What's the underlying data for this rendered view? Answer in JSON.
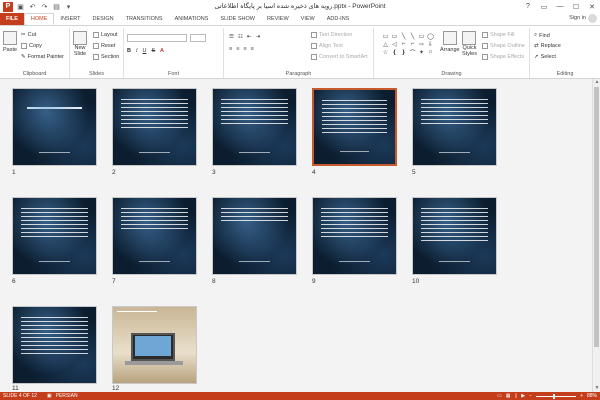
{
  "window": {
    "app_logo": "P",
    "title": "رویه های ذخیره شده اسیا بر پایگاه اطلاعاتی.pptx - PowerPoint",
    "controls": [
      "?",
      "▭",
      "—",
      "☐",
      "✕"
    ]
  },
  "tabs": [
    {
      "label": "FILE"
    },
    {
      "label": "HOME"
    },
    {
      "label": "INSERT"
    },
    {
      "label": "DESIGN"
    },
    {
      "label": "TRANSITIONS"
    },
    {
      "label": "ANIMATIONS"
    },
    {
      "label": "SLIDE SHOW"
    },
    {
      "label": "REVIEW"
    },
    {
      "label": "VIEW"
    },
    {
      "label": "ADD-INS"
    }
  ],
  "active_tab": "HOME",
  "sign_in": "Sign in",
  "ribbon": {
    "clipboard": {
      "paste": "Paste",
      "cut": "Cut",
      "copy": "Copy",
      "format_painter": "Format Painter",
      "label": "Clipboard"
    },
    "slides": {
      "new_slide": "New",
      "new_slide_2": "Slide",
      "layout": "Layout",
      "reset": "Reset",
      "section": "Section",
      "label": "Slides"
    },
    "font": {
      "label": "Font",
      "bold": "B",
      "italic": "I",
      "underline": "U",
      "strike": "S",
      "aa": "A"
    },
    "paragraph": {
      "text_direction": "Text Direction",
      "align_text": "Align Text",
      "convert_smartart": "Convert to SmartArt",
      "label": "Paragraph"
    },
    "drawing": {
      "arrange": "Arrange",
      "quick_styles": "Quick",
      "quick_styles_2": "Styles",
      "shape_fill": "Shape Fill",
      "shape_outline": "Shape Outline",
      "shape_effects": "Shape Effects",
      "label": "Drawing"
    },
    "editing": {
      "find": "Find",
      "replace": "Replace",
      "select": "Select",
      "label": "Editing"
    }
  },
  "shapes": [
    "▭",
    "▭",
    "╲",
    "╲",
    "▭",
    "◯",
    "△",
    "◁",
    "⌐",
    "⌐",
    "⇨",
    "⇩",
    "☆",
    "❴",
    "❵",
    "⌒",
    "✦",
    "☼"
  ],
  "slides": [
    {
      "num": "1"
    },
    {
      "num": "2"
    },
    {
      "num": "3"
    },
    {
      "num": "4"
    },
    {
      "num": "5"
    },
    {
      "num": "6"
    },
    {
      "num": "7"
    },
    {
      "num": "8"
    },
    {
      "num": "9"
    },
    {
      "num": "10"
    },
    {
      "num": "11"
    },
    {
      "num": "12"
    }
  ],
  "selected_slide": "4",
  "status": {
    "slide": "SLIDE 4 OF 12",
    "lang": "PERSIAN",
    "zoom": "88%"
  }
}
